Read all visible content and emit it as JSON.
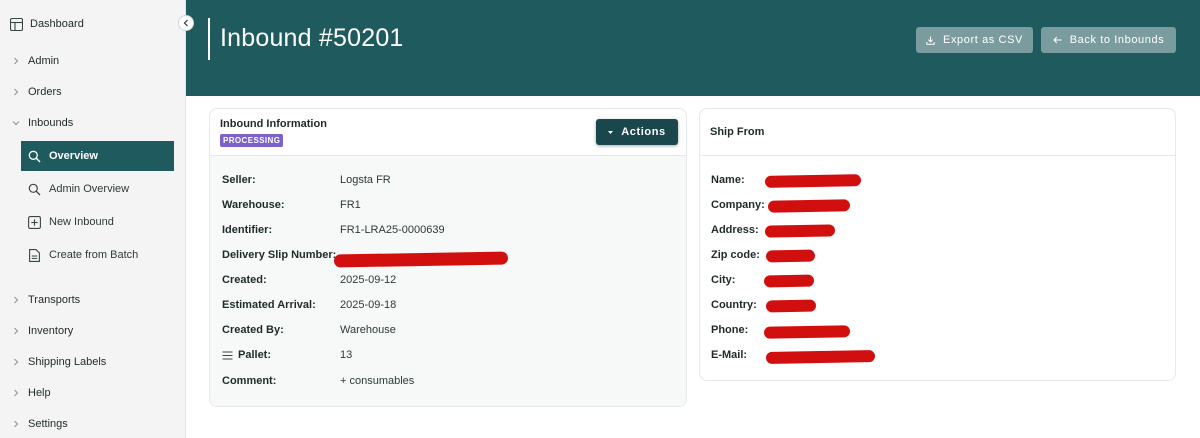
{
  "sidebar": {
    "dashboard": "Dashboard",
    "items": {
      "admin": "Admin",
      "orders": "Orders",
      "inbounds": "Inbounds",
      "transports": "Transports",
      "inventory": "Inventory",
      "shipping_labels": "Shipping Labels",
      "help": "Help",
      "settings": "Settings"
    },
    "inbounds_sub": {
      "overview": "Overview",
      "admin_overview": "Admin Overview",
      "new_inbound": "New Inbound",
      "create_from_batch": "Create from Batch"
    }
  },
  "header": {
    "title": "Inbound #50201",
    "export_label": "Export as CSV",
    "back_label": "Back to Inbounds"
  },
  "inbound_info": {
    "title": "Inbound Information",
    "status": "PROCESSING",
    "actions_label": "Actions",
    "fields": {
      "seller": {
        "label": "Seller:",
        "value": "Logsta FR"
      },
      "warehouse": {
        "label": "Warehouse:",
        "value": "FR1"
      },
      "identifier": {
        "label": "Identifier:",
        "value": "FR1-LRA25-0000639"
      },
      "delivery_slip": {
        "label": "Delivery Slip Number:",
        "value": ""
      },
      "created": {
        "label": "Created:",
        "value": "2025-09-12"
      },
      "estimated_arrival": {
        "label": "Estimated Arrival:",
        "value": "2025-09-18"
      },
      "created_by": {
        "label": "Created By:",
        "value": "Warehouse"
      },
      "pallet": {
        "label": "Pallet:",
        "value": "13"
      },
      "comment": {
        "label": "Comment:",
        "value": "+ consumables"
      }
    }
  },
  "ship_from": {
    "title": "Ship From",
    "fields": {
      "name": "Name:",
      "company": "Company:",
      "address": "Address:",
      "zip": "Zip code:",
      "city": "City:",
      "country": "Country:",
      "phone": "Phone:",
      "email": "E-Mail:"
    }
  },
  "colors": {
    "brand": "#1e5a5e",
    "header_button": "#7b9c9e",
    "actions_button": "#1a474b",
    "status_badge": "#7b61c9",
    "redaction": "#d20f0f"
  },
  "icons": {
    "dashboard": "dashboard-icon",
    "chevron_right": "chevron-right-icon",
    "chevron_down": "chevron-down-icon",
    "search": "search-icon",
    "plus_box": "plus-square-icon",
    "document": "document-icon",
    "download": "download-icon",
    "arrow_left": "arrow-left-icon",
    "menu": "menu-lines-icon",
    "caret": "caret-down-icon",
    "collapse": "chevron-left-icon"
  }
}
